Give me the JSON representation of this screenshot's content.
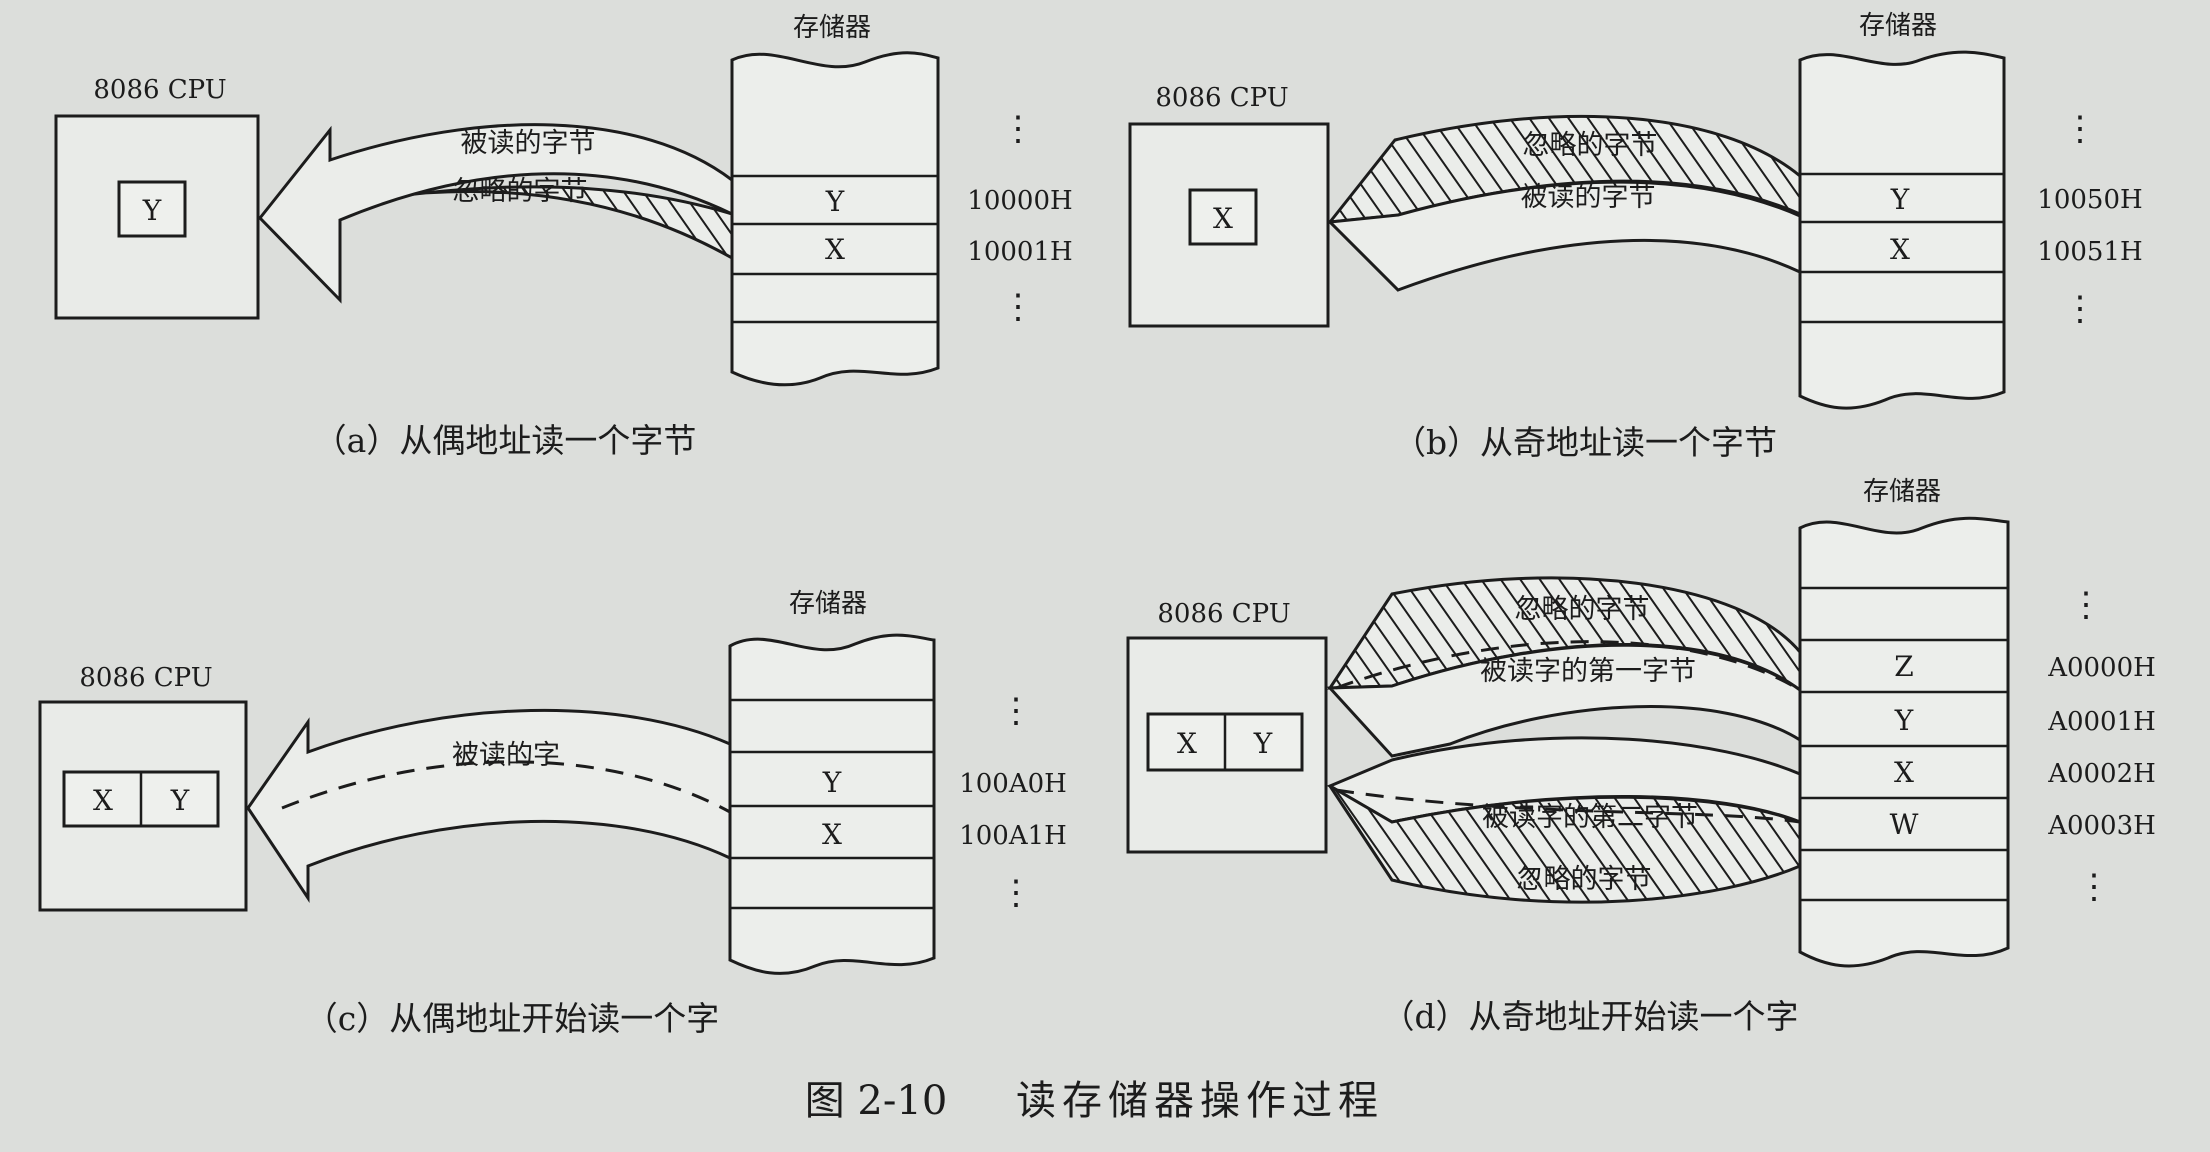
{
  "figure": {
    "caption_label": "图 2-10",
    "caption_text": "读存储器操作过程"
  },
  "panels": {
    "a": {
      "cpu_label": "8086 CPU",
      "register": "Y",
      "memory_label": "存储器",
      "cells": [
        "Y",
        "X"
      ],
      "addresses": [
        "10000H",
        "10001H"
      ],
      "upper_stream_label": "被读的字节",
      "lower_stream_label": "忽略的字节",
      "caption": "（a）从偶地址读一个字节"
    },
    "b": {
      "cpu_label": "8086 CPU",
      "register": "X",
      "memory_label": "存储器",
      "cells": [
        "Y",
        "X"
      ],
      "addresses": [
        "10050H",
        "10051H"
      ],
      "upper_stream_label": "忽略的字节",
      "lower_stream_label": "被读的字节",
      "caption": "（b）从奇地址读一个字节"
    },
    "c": {
      "cpu_label": "8086 CPU",
      "register_left": "X",
      "register_right": "Y",
      "memory_label": "存储器",
      "cells": [
        "Y",
        "X"
      ],
      "addresses": [
        "100A0H",
        "100A1H"
      ],
      "stream_label": "被读的字",
      "caption": "（c）从偶地址开始读一个字"
    },
    "d": {
      "cpu_label": "8086 CPU",
      "register_left": "X",
      "register_right": "Y",
      "memory_label": "存储器",
      "cells": [
        "Z",
        "Y",
        "X",
        "W"
      ],
      "addresses": [
        "A0000H",
        "A0001H",
        "A0002H",
        "A0003H"
      ],
      "ignored_top_label": "忽略的字节",
      "first_byte_label": "被读字的第一字节",
      "second_byte_label": "被读字的第二字节",
      "ignored_bottom_label": "忽略的字节",
      "caption": "（d）从奇地址开始读一个字"
    }
  },
  "ellipsis": "⋮"
}
